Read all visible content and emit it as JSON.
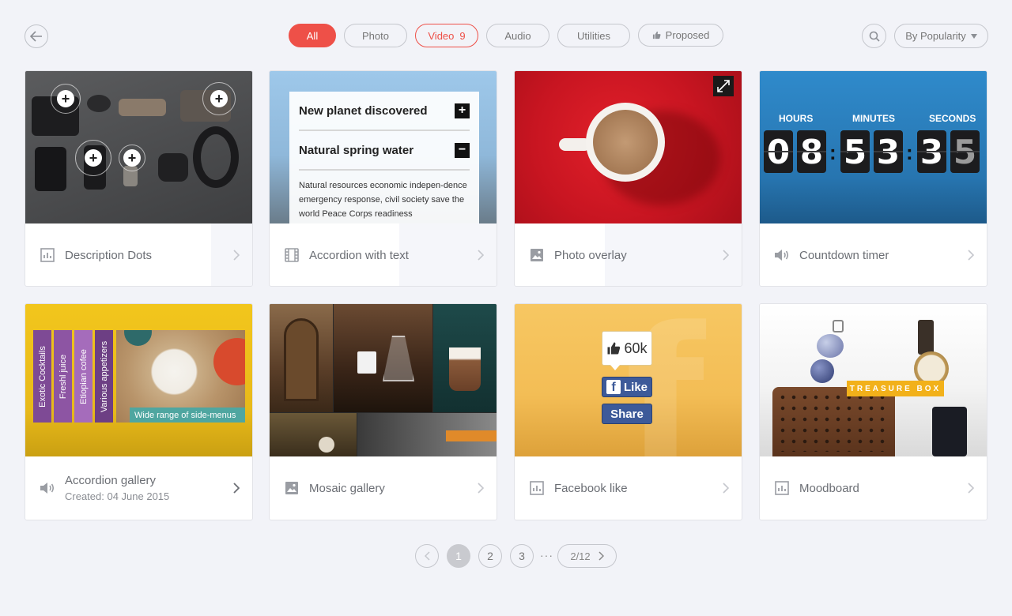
{
  "filters": [
    {
      "label": "All"
    },
    {
      "label": "Photo"
    },
    {
      "label": "Video",
      "count": "9"
    },
    {
      "label": "Audio"
    },
    {
      "label": "Utilities"
    },
    {
      "label": "Proposed"
    }
  ],
  "sort": {
    "label": "By Popularity"
  },
  "cards": [
    {
      "title": "Description Dots",
      "icon": "bar-chart-icon"
    },
    {
      "title": "Accordion with text",
      "icon": "film-icon",
      "accordion": {
        "item1": "New planet discovered",
        "item2": "Natural spring water",
        "text": "Natural resources economic indepen-dence emergency response, civil society save the world Peace Corps readiness"
      }
    },
    {
      "title": "Photo overlay",
      "icon": "image-icon"
    },
    {
      "title": "Countdown timer",
      "icon": "speaker-icon",
      "timer": {
        "hours_label": "HOURS",
        "minutes_label": "MINUTES",
        "seconds_label": "SECONDS",
        "digits": [
          "0",
          "8",
          "5",
          "3",
          "3",
          "5"
        ]
      }
    },
    {
      "title": "Accordion gallery",
      "subtitle": "Created: 04 June 2015",
      "icon": "speaker-icon",
      "tabs": [
        "Exotic Cocktails",
        "Freshl juice",
        "Etiopian cofee",
        "Various appetizers"
      ],
      "caption": "Wide range of side-menus"
    },
    {
      "title": "Mosaic gallery",
      "icon": "image-icon"
    },
    {
      "title": "Facebook like",
      "icon": "bar-chart-icon",
      "fb": {
        "count": "60k",
        "like": "Like",
        "share": "Share"
      }
    },
    {
      "title": "Moodboard",
      "icon": "bar-chart-icon",
      "label": "TREASURE BOX"
    }
  ],
  "pagination": {
    "pages": [
      "1",
      "2",
      "3"
    ],
    "current": "1",
    "ellipsis": "···",
    "jump": "2/12"
  },
  "colors": {
    "accent": "#ee5048",
    "background": "#f2f3f8"
  }
}
